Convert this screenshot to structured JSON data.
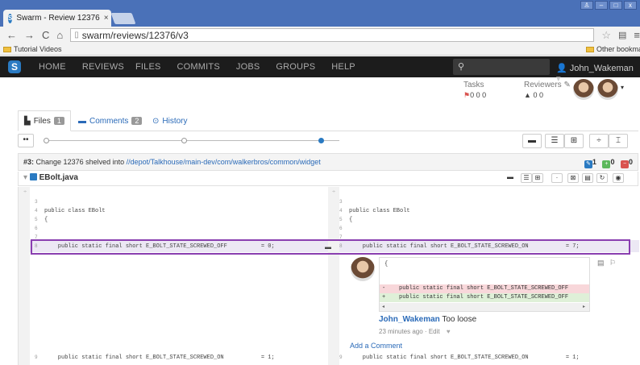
{
  "browser": {
    "tab_title": "Swarm - Review 12376",
    "tab_close": "×",
    "url": "swarm/reviews/12376/v3",
    "bookmark1": "Tutorial Videos",
    "bookmark_other": "Other bookmarks",
    "win_min": "–",
    "win_max": "□",
    "win_close": "x"
  },
  "nav": {
    "logo": "S",
    "items": [
      "HOME",
      "REVIEWS",
      "FILES",
      "COMMITS",
      "JOBS",
      "GROUPS",
      "HELP"
    ],
    "search_placeholder": "",
    "user": "John_Wakeman ▾"
  },
  "review": {
    "tasks_label": "Tasks",
    "tasks_counts": "0  0  0",
    "reviewers_label": "Reviewers",
    "reviewers_counts": "0  0"
  },
  "tabs": [
    {
      "label": "Files",
      "badge": "1"
    },
    {
      "label": "Comments",
      "badge": "2"
    },
    {
      "label": "History",
      "badge": ""
    }
  ],
  "change": {
    "prefix": "#3:",
    "text": "Change 12376 shelved into",
    "path": "//depot/Talkhouse/main-dev/com/walkerbros/common/widget",
    "counts": [
      "1",
      "0",
      "0"
    ]
  },
  "file": {
    "name": "EBolt.java"
  },
  "diff": {
    "left": [
      {
        "n": "3",
        "t": ""
      },
      {
        "n": "4",
        "t": "public class EBolt"
      },
      {
        "n": "5",
        "t": "{"
      },
      {
        "n": "6",
        "t": ""
      },
      {
        "n": "7",
        "t": ""
      },
      {
        "n": "8",
        "t": "    public static final short E_BOLT_STATE_SCREWED_OFF          = 0;"
      },
      {
        "n": "9",
        "t": "    public static final short E_BOLT_STATE_SCREWED_ON           = 1;"
      }
    ],
    "right": [
      {
        "n": "3",
        "t": ""
      },
      {
        "n": "4",
        "t": "public class EBolt"
      },
      {
        "n": "5",
        "t": "{"
      },
      {
        "n": "6",
        "t": ""
      },
      {
        "n": "7",
        "t": ""
      },
      {
        "n": "8",
        "t": "    public static final short E_BOLT_STATE_SCREWED_ON           = 7;"
      },
      {
        "n": "9",
        "t": "    public static final short E_BOLT_STATE_SCREWED_ON           = 1;"
      }
    ]
  },
  "comment": {
    "line0": "{",
    "del": "-    public static final short E_BOLT_STATE_SCREWED_OFF",
    "add": "+    public static final short E_BOLT_STATE_SCREWED_OFF",
    "author": "John_Wakeman",
    "text": "Too loose",
    "meta": "23 minutes ago · Edit",
    "add_comment": "Add a Comment"
  }
}
